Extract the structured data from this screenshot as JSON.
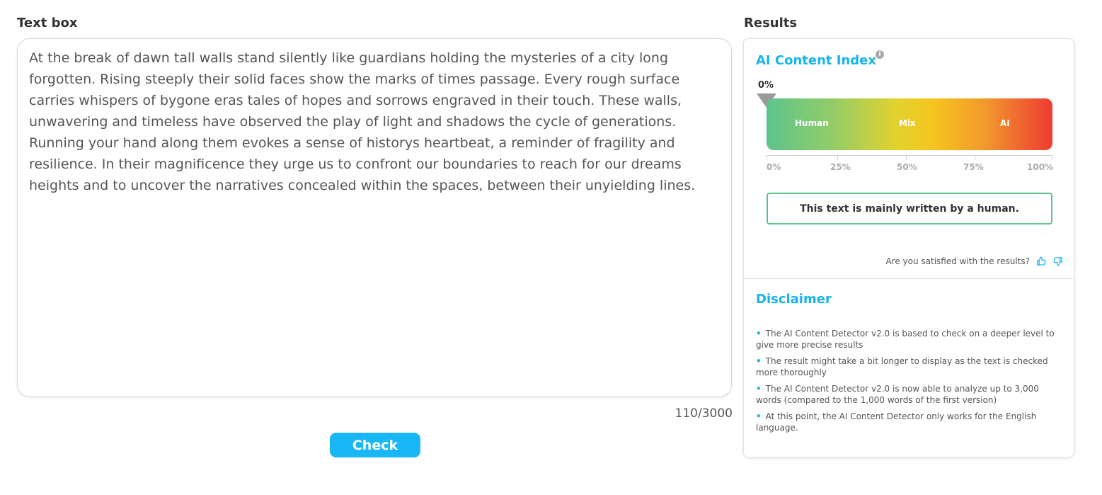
{
  "text_box": {
    "title": "Text box",
    "content": "At the break of dawn tall walls stand silently like guardians holding the mysteries of a city long forgotten. Rising steeply their solid faces show the marks of times passage. Every rough surface carries whispers of bygone eras tales of hopes and sorrows engraved in their touch. These walls, unwavering and timeless have observed the play of light and shadows the cycle of generations. Running your hand along them evokes a sense of historys heartbeat, a reminder of fragility and resilience. In their magnificence they urge us to confront our boundaries to reach for our dreams heights and to uncover the narratives concealed within the spaces, between their unyielding lines.",
    "counter": "110/3000",
    "check_label": "Check"
  },
  "results": {
    "title": "Results",
    "ai_index_title": "AI Content Index",
    "info_icon": "info-icon",
    "score_label": "0%",
    "score_value": 0,
    "gauge_labels": {
      "human": "Human",
      "mix": "Mix",
      "ai": "AI"
    },
    "ticks": [
      "0%",
      "25%",
      "50%",
      "75%",
      "100%"
    ],
    "verdict": "This text is mainly written by a human.",
    "satisfaction_prompt": "Are you satisfied with the results?",
    "thumbs_up_icon": "thumbs-up-icon",
    "thumbs_down_icon": "thumbs-down-icon"
  },
  "disclaimer": {
    "title": "Disclaimer",
    "items": [
      "The AI Content Detector v2.0 is based to check on a deeper level to give more precise results",
      "The result might take a bit longer to display as the text is checked more thoroughly",
      "The AI Content Detector v2.0 is now able to analyze up to 3,000 words (compared to the 1,000 words of the first version)",
      "At this point, the AI Content Detector only works for the English language."
    ]
  },
  "colors": {
    "accent": "#16b3ef",
    "button": "#19b7f5",
    "human_green": "#5ec48c",
    "ai_red": "#ef3b33"
  }
}
